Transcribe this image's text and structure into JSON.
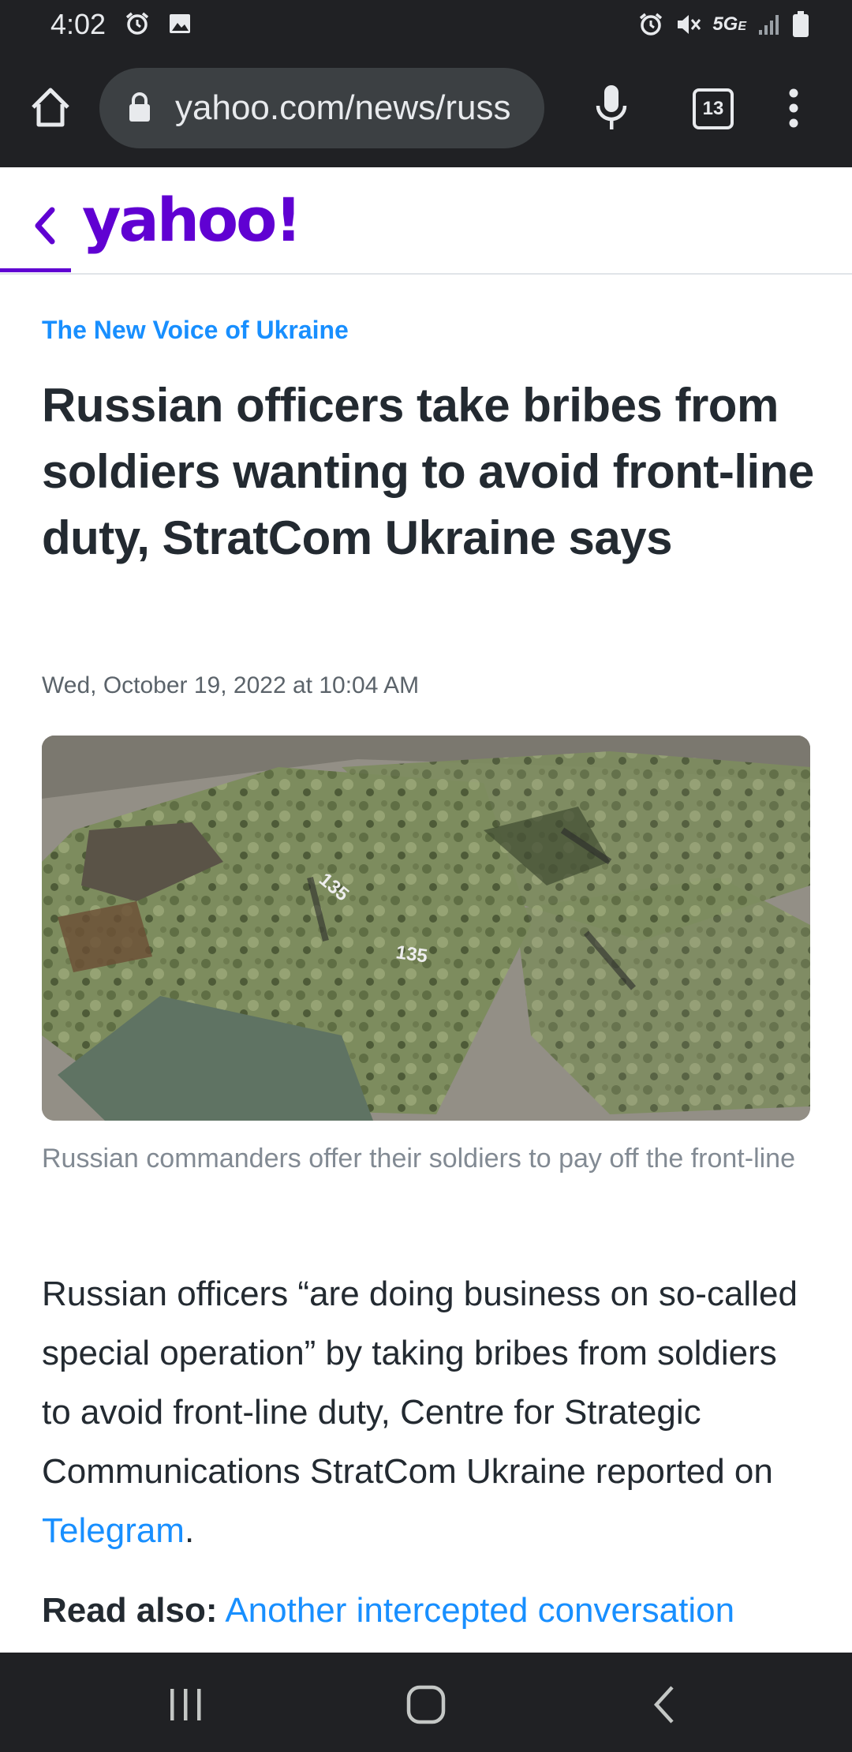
{
  "status_bar": {
    "time": "4:02",
    "network_label": "5G",
    "network_sub": "E"
  },
  "browser": {
    "url": "yahoo.com/news/russ",
    "tab_count": "13"
  },
  "site": {
    "logo": "yahoo!",
    "accent_color": "#6001d2"
  },
  "article": {
    "source": "The New Voice of Ukraine",
    "headline": "Russian officers take bribes from soldiers wanting to avoid front-line duty, StratCom Ukraine says",
    "date": "Wed, October 19, 2022 at 10:04 AM",
    "image_caption": "Russian commanders offer their soldiers to pay off the front-line",
    "image_labels": [
      "135",
      "135"
    ],
    "body_text": "Russian officers “are doing business on so-called special operation” by taking bribes from soldiers to avoid front-line duty, Centre for Strategic Communications StratCom Ukraine reported on ",
    "body_link": "Telegram",
    "body_end": ".",
    "read_also_label": "Read also:",
    "read_also_link": "Another intercepted conversation"
  },
  "icons": {
    "home": "home-icon",
    "lock": "lock-icon",
    "mic": "microphone-icon",
    "menu": "more-vert-icon",
    "back": "chevron-left-icon"
  }
}
